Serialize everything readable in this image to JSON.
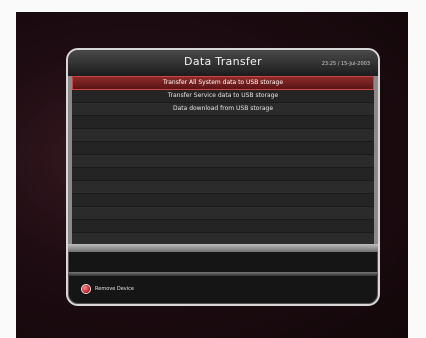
{
  "header": {
    "title": "Data Transfer",
    "datetime": "23:25 / 15-Jul-2003"
  },
  "menu": {
    "items": [
      {
        "label": "Transfer All System data to USB storage",
        "selected": true
      },
      {
        "label": "Transfer Service data to USB storage"
      },
      {
        "label": "Data download from USB storage"
      },
      {
        "label": ""
      },
      {
        "label": ""
      },
      {
        "label": ""
      },
      {
        "label": ""
      },
      {
        "label": ""
      },
      {
        "label": ""
      },
      {
        "label": ""
      },
      {
        "label": ""
      },
      {
        "label": ""
      },
      {
        "label": ""
      }
    ]
  },
  "footer": {
    "hint_key_color": "#c01a1a",
    "hint_label": "Remove Device"
  }
}
